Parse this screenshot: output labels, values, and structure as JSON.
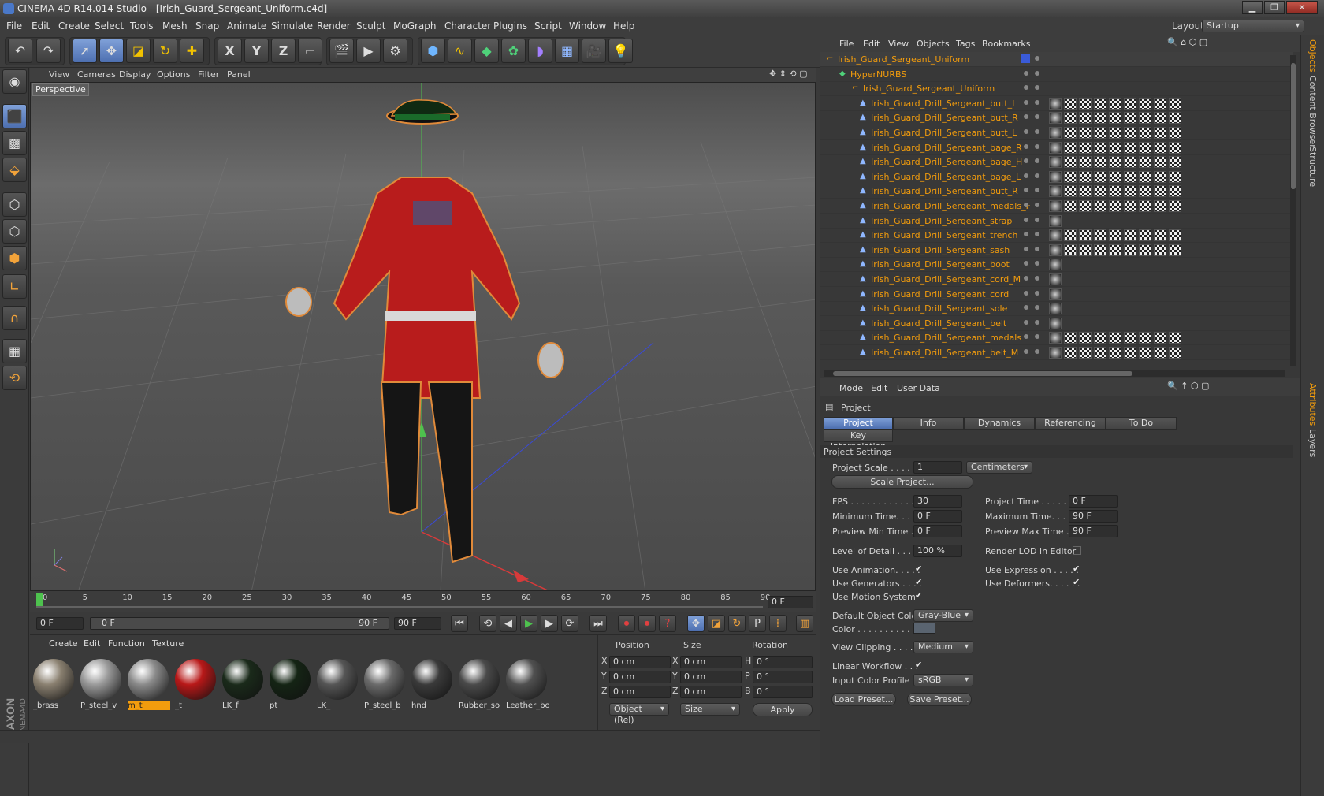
{
  "window": {
    "title": "CINEMA 4D R14.014 Studio - [Irish_Guard_Sergeant_Uniform.c4d]",
    "layout_label": "Layout:",
    "layout_value": "Startup"
  },
  "menu": [
    "File",
    "Edit",
    "Create",
    "Select",
    "Tools",
    "Mesh",
    "Snap",
    "Animate",
    "Simulate",
    "Render",
    "Sculpt",
    "MoGraph",
    "Character",
    "Plugins",
    "Script",
    "Window",
    "Help"
  ],
  "toolbar": {
    "icons": [
      "undo-icon",
      "redo-icon",
      "live-select-icon",
      "move-icon",
      "scale-icon",
      "rotate-icon",
      "last-tool-icon",
      "x-axis-icon",
      "y-axis-icon",
      "z-axis-icon",
      "coord-system-icon",
      "render-view-icon",
      "render-picture-queue-icon",
      "edit-render-settings-icon",
      "cube-icon",
      "spline-icon",
      "nurbs-icon",
      "array-icon",
      "deformer-icon",
      "floor-icon",
      "camera-icon",
      "light-icon"
    ],
    "axis_labels": [
      "X",
      "Y",
      "Z"
    ]
  },
  "viewport": {
    "menu": [
      "View",
      "Cameras",
      "Display",
      "Options",
      "Filter",
      "Panel"
    ],
    "label": "Perspective"
  },
  "timeline": {
    "ticks": [
      "0",
      "5",
      "10",
      "15",
      "20",
      "25",
      "30",
      "35",
      "40",
      "45",
      "50",
      "55",
      "60",
      "65",
      "70",
      "75",
      "80",
      "85",
      "90"
    ],
    "current": "0 F",
    "start": "0 F",
    "slider_start": "0 F",
    "slider_end": "90 F",
    "end": "90 F"
  },
  "materials": {
    "menu": [
      "Create",
      "Edit",
      "Function",
      "Texture"
    ],
    "items": [
      {
        "label": "_brass",
        "color": "#8a8070",
        "selected": false
      },
      {
        "label": "P_steel_v",
        "color": "#9a9a9a",
        "selected": false
      },
      {
        "label": "m_t",
        "color": "#8a8a8a",
        "selected": true
      },
      {
        "label": "_t",
        "color": "#b81818",
        "selected": false
      },
      {
        "label": "LK_f",
        "color": "#1a2a1a",
        "selected": false
      },
      {
        "label": "pt",
        "color": "#142414",
        "selected": false
      },
      {
        "label": "LK_",
        "color": "#555555",
        "selected": false
      },
      {
        "label": "P_steel_b",
        "color": "#6a6a6a",
        "selected": false
      },
      {
        "label": "hnd",
        "color": "#3a3a3a",
        "selected": false
      },
      {
        "label": "Rubber_so",
        "color": "#4a4a4a",
        "selected": false
      },
      {
        "label": "Leather_bo",
        "color": "#505050",
        "selected": false
      }
    ]
  },
  "coords": {
    "headers": [
      "Position",
      "Size",
      "Rotation"
    ],
    "rows": [
      {
        "a": "X",
        "pos": "0 cm",
        "b": "X",
        "size": "0 cm",
        "c": "H",
        "rot": "0 °"
      },
      {
        "a": "Y",
        "pos": "0 cm",
        "b": "Y",
        "size": "0 cm",
        "c": "P",
        "rot": "0 °"
      },
      {
        "a": "Z",
        "pos": "0 cm",
        "b": "Z",
        "size": "0 cm",
        "c": "B",
        "rot": "0 °"
      }
    ],
    "mode": "Object (Rel)",
    "size_mode": "Size",
    "apply": "Apply"
  },
  "objects": {
    "menu": [
      "File",
      "Edit",
      "View",
      "Objects",
      "Tags",
      "Bookmarks"
    ],
    "root": "Irish_Guard_Sergeant_Uniform",
    "hypernurbs": "HyperNURBS",
    "group": "Irish_Guard_Sergeant_Uniform",
    "children": [
      {
        "name": "Irish_Guard_Drill_Sergeant_butt_L",
        "tags": 9
      },
      {
        "name": "Irish_Guard_Drill_Sergeant_butt_R",
        "tags": 9
      },
      {
        "name": "Irish_Guard_Drill_Sergeant_butt_L",
        "tags": 9
      },
      {
        "name": "Irish_Guard_Drill_Sergeant_bage_R",
        "tags": 9
      },
      {
        "name": "Irish_Guard_Drill_Sergeant_bage_H",
        "tags": 9
      },
      {
        "name": "Irish_Guard_Drill_Sergeant_bage_L",
        "tags": 9
      },
      {
        "name": "Irish_Guard_Drill_Sergeant_butt_R",
        "tags": 9
      },
      {
        "name": "Irish_Guard_Drill_Sergeant_medals_F",
        "tags": 9
      },
      {
        "name": "Irish_Guard_Drill_Sergeant_strap",
        "tags": 1
      },
      {
        "name": "Irish_Guard_Drill_Sergeant_trench",
        "tags": 9
      },
      {
        "name": "Irish_Guard_Drill_Sergeant_sash",
        "tags": 9
      },
      {
        "name": "Irish_Guard_Drill_Sergeant_boot",
        "tags": 1
      },
      {
        "name": "Irish_Guard_Drill_Sergeant_cord_M",
        "tags": 1
      },
      {
        "name": "Irish_Guard_Drill_Sergeant_cord",
        "tags": 1
      },
      {
        "name": "Irish_Guard_Drill_Sergeant_sole",
        "tags": 1
      },
      {
        "name": "Irish_Guard_Drill_Sergeant_belt",
        "tags": 1
      },
      {
        "name": "Irish_Guard_Drill_Sergeant_medals",
        "tags": 9
      },
      {
        "name": "Irish_Guard_Drill_Sergeant_belt_M",
        "tags": 9
      }
    ]
  },
  "attributes": {
    "menu": [
      "Mode",
      "Edit",
      "User Data"
    ],
    "header": "Project",
    "tabs": [
      "Project Settings",
      "Info",
      "Dynamics",
      "Referencing",
      "To Do"
    ],
    "tab2": "Key Interpolation",
    "section": "Project Settings",
    "project_scale_label": "Project Scale . . . . . .",
    "project_scale": "1",
    "scale_unit": "Centimeters",
    "scale_project_btn": "Scale Project...",
    "fps_label": "FPS . . . . . . . . . . . . . .",
    "fps": "30",
    "project_time_label": "Project Time . . . . . . . .",
    "project_time": "0 F",
    "min_time_label": "Minimum Time. . . . .",
    "min_time": "0 F",
    "max_time_label": "Maximum Time. . . . . .",
    "max_time": "90 F",
    "prev_min_label": "Preview Min Time . . .",
    "prev_min": "0 F",
    "prev_max_label": "Preview Max Time . . .",
    "prev_max": "90 F",
    "lod_label": "Level of Detail . . . . .",
    "lod": "100 %",
    "render_lod_label": "Render LOD in Editor",
    "use_anim": "Use Animation. . . . .",
    "use_expr": "Use Expression . . . . .",
    "use_gen": "Use Generators . . . .",
    "use_def": "Use Deformers. . . . . .",
    "use_motion": "Use Motion System",
    "def_color_label": "Default Object Color",
    "def_color": "Gray-Blue",
    "color_label": "Color . . . . . . . . . . .",
    "view_clip_label": "View Clipping . . . . .",
    "view_clip": "Medium",
    "linear_label": "Linear Workflow . . .",
    "input_profile_label": "Input Color Profile . .",
    "input_profile": "sRGB",
    "load_preset": "Load Preset...",
    "save_preset": "Save Preset..."
  },
  "sidetabs": [
    "Objects",
    "Content Browser",
    "Structure",
    "Attributes",
    "Layers"
  ],
  "colors": {
    "accent": "#f29c0d",
    "selected_blue": "#5a7fc0"
  }
}
